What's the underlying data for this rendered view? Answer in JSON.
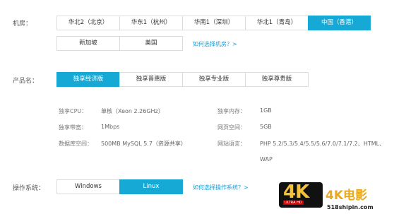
{
  "region": {
    "label": "机房：",
    "options": [
      "华北2（北京）",
      "华东1（杭州）",
      "华南1（深圳）",
      "华北1（青岛）",
      "中国（香港）",
      "新加坡",
      "美国"
    ],
    "selected": "中国（香港）",
    "help_link": "如何选择机房？>"
  },
  "product": {
    "label": "产品名：",
    "options": [
      "独享经济版",
      "独享普惠版",
      "独享专业版",
      "独享尊贵版"
    ],
    "selected": "独享经济版"
  },
  "specs": {
    "cpu_label": "独享CPU：",
    "cpu_value": "单核（Xeon 2.26GHz）",
    "memory_label": "独享内存：",
    "memory_value": "1GB",
    "bandwidth_label": "独享带宽：",
    "bandwidth_value": "1Mbps",
    "web_space_label": "网页空间：",
    "web_space_value": "5GB",
    "db_label": "数据库空间：",
    "db_value": "500MB MySQL 5.7（资源共享）",
    "lang_label": "网站语言：",
    "lang_value_line1": "PHP 5.2/5.3/5.4/5.5/5.6/7.0/7.1/7.2、HTML、",
    "lang_value_line2": "WAP"
  },
  "os": {
    "label": "操作系统：",
    "options": [
      "Windows",
      "Linux"
    ],
    "selected": "Linux",
    "help_link": "如何选择操作系统？>"
  },
  "watermark": {
    "logo_text": "4K",
    "logo_sub": "ULTRA HD",
    "title": "4K电影",
    "url": "518shipin.com"
  },
  "colors": {
    "accent": "#17a9d6",
    "link": "#1b9bd1",
    "border": "#dcdcdc"
  }
}
